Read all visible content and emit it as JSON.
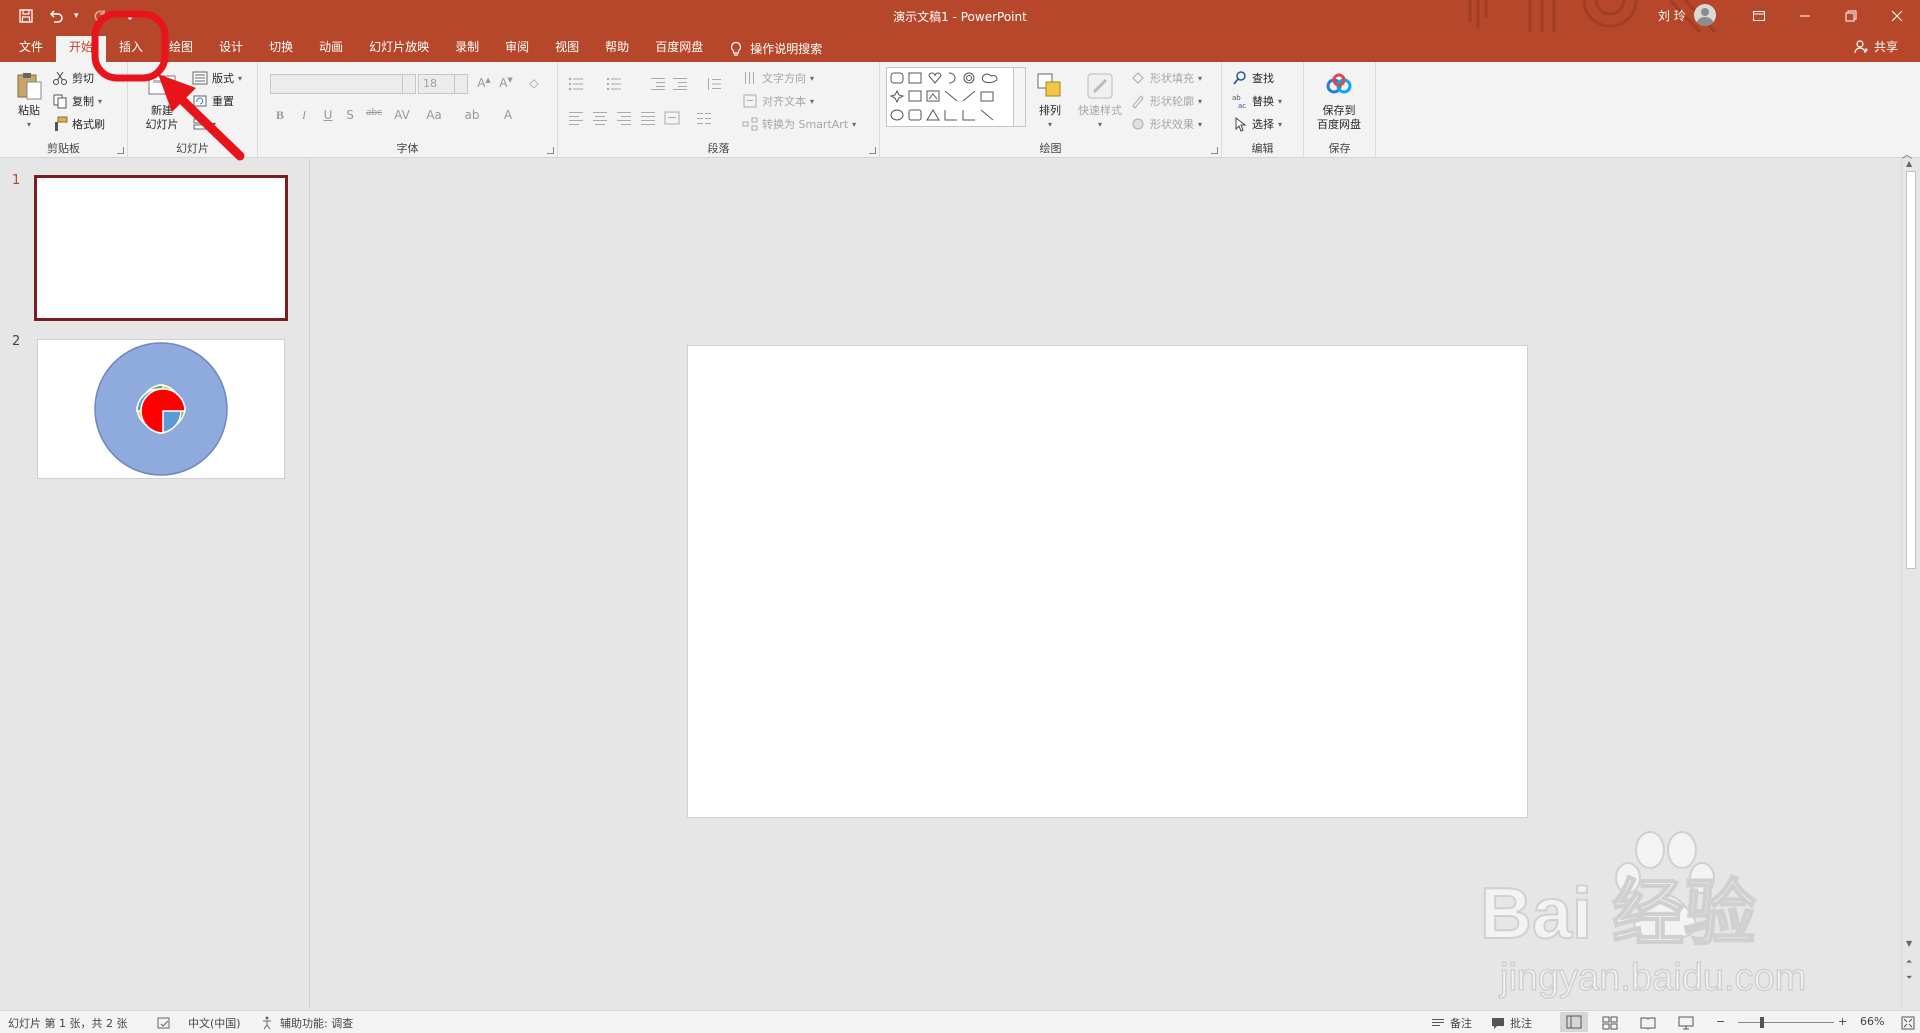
{
  "window": {
    "title": "演示文稿1 - PowerPoint",
    "user_name": "刘 玲"
  },
  "tabs": [
    {
      "label": "文件"
    },
    {
      "label": "开始",
      "active": true
    },
    {
      "label": "插入"
    },
    {
      "label": "绘图"
    },
    {
      "label": "设计"
    },
    {
      "label": "切换"
    },
    {
      "label": "动画"
    },
    {
      "label": "幻灯片放映"
    },
    {
      "label": "录制"
    },
    {
      "label": "审阅"
    },
    {
      "label": "视图"
    },
    {
      "label": "帮助"
    },
    {
      "label": "百度网盘"
    }
  ],
  "tell_me": "操作说明搜索",
  "share": "共享",
  "ribbon": {
    "clipboard": {
      "label": "剪贴板",
      "paste": "粘贴",
      "cut": "剪切",
      "copy": "复制",
      "format_painter": "格式刷"
    },
    "slides": {
      "label": "幻灯片",
      "new_slide_line1": "新建",
      "new_slide_line2": "幻灯片",
      "layout": "版式",
      "reset": "重置"
    },
    "font": {
      "label": "字体",
      "size": "18"
    },
    "paragraph": {
      "label": "段落",
      "text_direction": "文字方向",
      "align_text": "对齐文本",
      "smartart": "转换为 SmartArt"
    },
    "drawing": {
      "label": "绘图",
      "arrange": "排列",
      "quick_styles": "快速样式",
      "shape_fill": "形状填充",
      "shape_outline": "形状轮廓",
      "shape_effects": "形状效果"
    },
    "editing": {
      "label": "编辑",
      "find": "查找",
      "replace": "替换",
      "select": "选择"
    },
    "save": {
      "label": "保存",
      "line1": "保存到",
      "line2": "百度网盘"
    }
  },
  "slides": [
    {
      "number": "1",
      "selected": true
    },
    {
      "number": "2",
      "selected": false,
      "petal_colors": [
        "#ffc000",
        "#70ad47",
        "#5b9bd5",
        "#ff0000"
      ],
      "circle_color": "#8faadc"
    }
  ],
  "status": {
    "slide_info": "幻灯片 第 1 张，共 2 张",
    "language": "中文(中国)",
    "accessibility": "辅助功能: 调查",
    "notes": "备注",
    "comments": "批注",
    "zoom": "66%"
  },
  "watermark": {
    "logo": "Bai 经验",
    "url": "jingyan.baidu.com"
  },
  "colors": {
    "accent": "#b7472a",
    "annotation": "#e8141b"
  }
}
